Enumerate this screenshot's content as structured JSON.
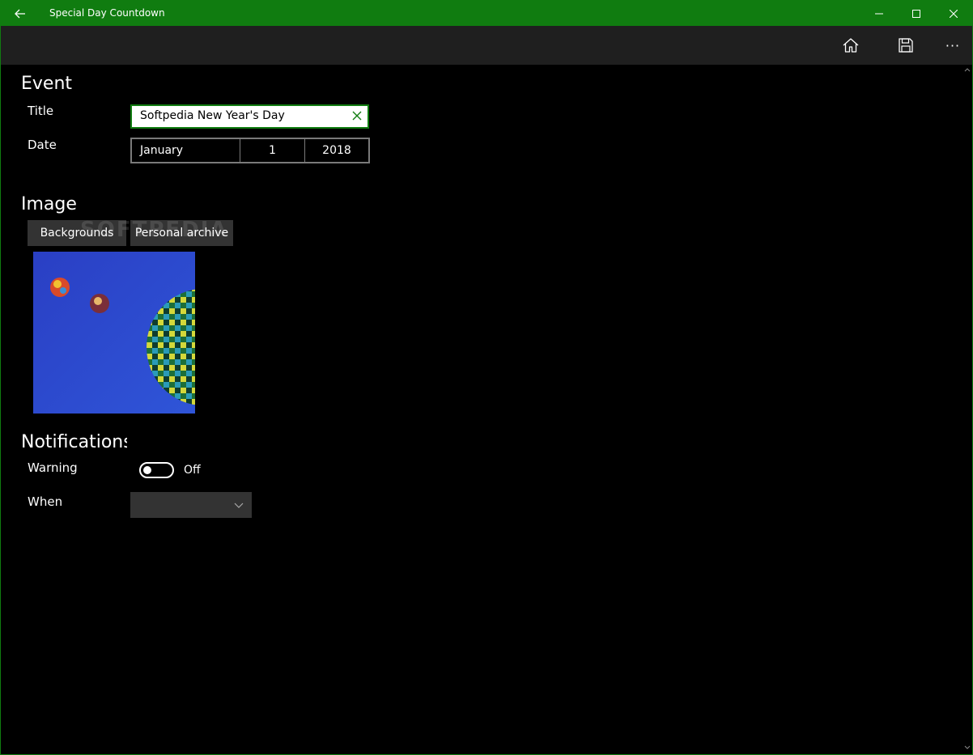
{
  "window": {
    "title": "Special Day Countdown",
    "accent": "#107c10"
  },
  "commandbar": {
    "home_icon": "home-icon",
    "save_icon": "save-icon",
    "more_icon": "more-icon",
    "more_label": "···"
  },
  "event": {
    "heading": "Event",
    "title_label": "Title",
    "title_value": "Softpedia New Year's Day",
    "date_label": "Date",
    "date": {
      "month": "January",
      "day": "1",
      "year": "2018"
    }
  },
  "image": {
    "heading": "Image",
    "backgrounds_button": "Backgrounds",
    "archive_button": "Personal archive",
    "watermark": "SOFTPEDIA",
    "preview": "hot air balloons on blue sky"
  },
  "notifications": {
    "heading": "Notifications",
    "warning_label": "Warning",
    "warning_state": "Off",
    "when_label": "When",
    "when_value": ""
  }
}
